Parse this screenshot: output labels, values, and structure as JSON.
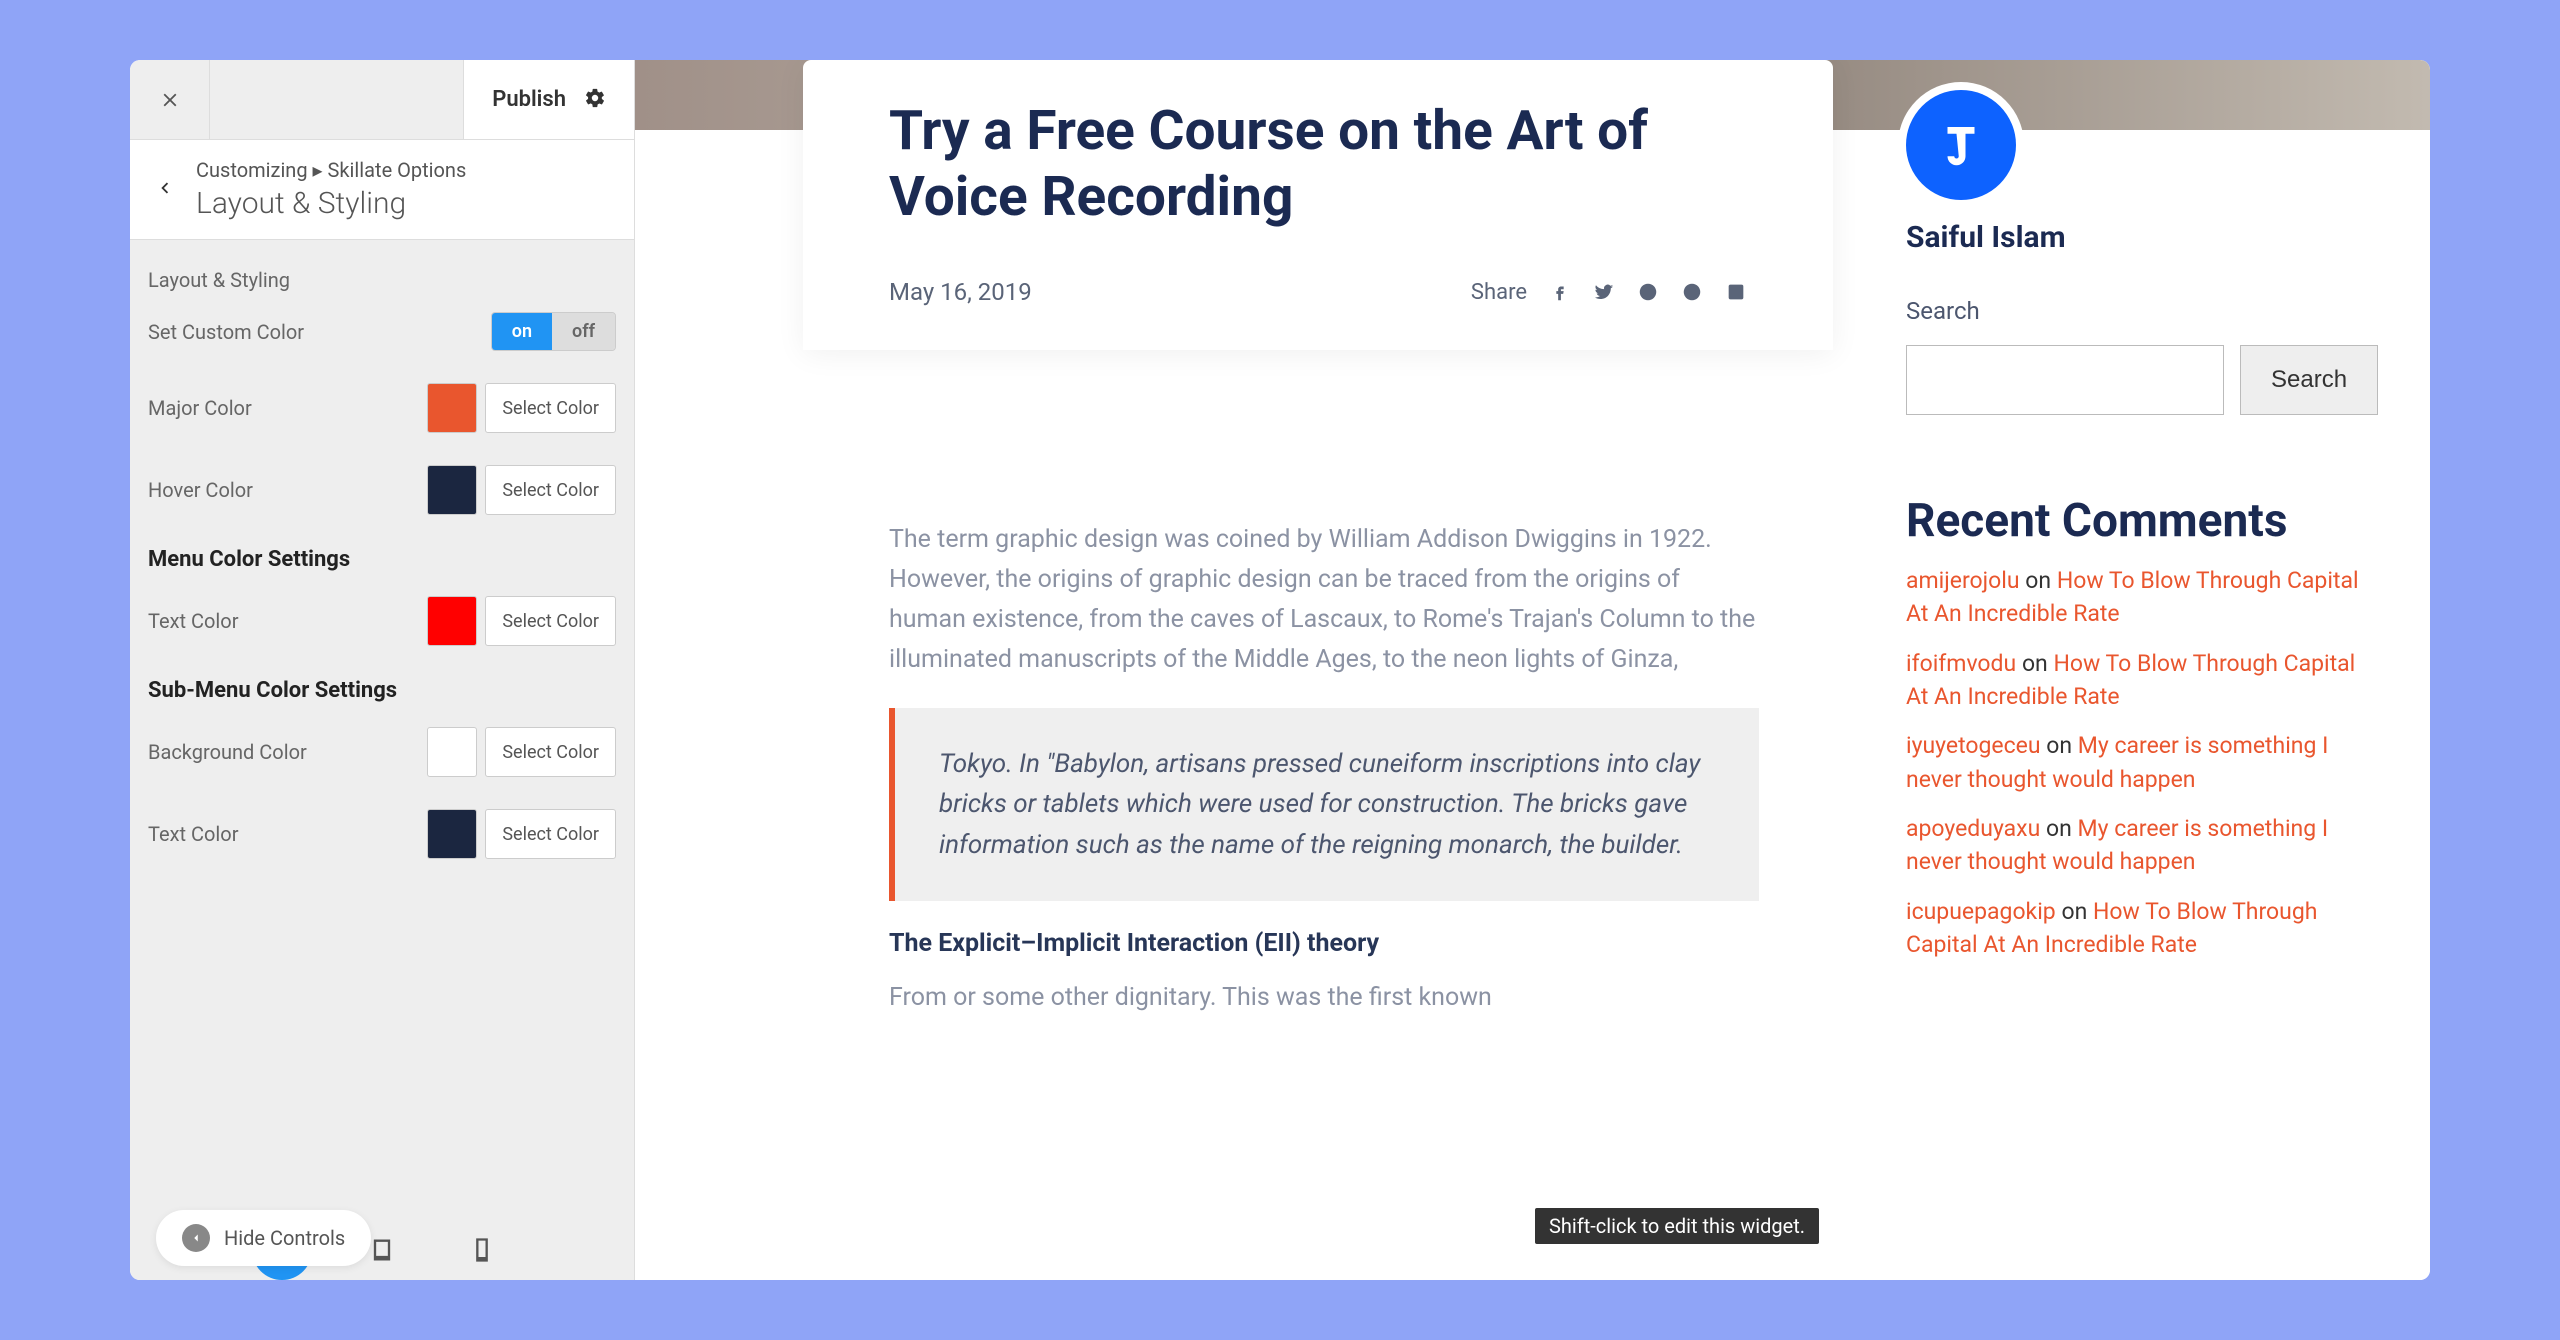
{
  "customizer": {
    "publish_label": "Publish",
    "breadcrumb_prefix": "Customizing ▸ Skillate Options",
    "breadcrumb_title": "Layout & Styling",
    "section_label": "Layout & Styling",
    "rows": {
      "set_custom_color": {
        "label": "Set Custom Color",
        "on": "on",
        "off": "off"
      },
      "major_color": {
        "label": "Major Color",
        "button": "Select Color",
        "swatch": "#e9562e"
      },
      "hover_color": {
        "label": "Hover Color",
        "button": "Select Color",
        "swatch": "#1b2640"
      },
      "menu_heading": "Menu Color Settings",
      "text_color": {
        "label": "Text Color",
        "button": "Select Color",
        "swatch": "#ff0000"
      },
      "submenu_heading": "Sub-Menu Color Settings",
      "bg_color": {
        "label": "Background Color",
        "button": "Select Color",
        "swatch": "#ffffff"
      },
      "sub_text_color": {
        "label": "Text Color",
        "button": "Select Color",
        "swatch": "#1b2640"
      }
    },
    "hide_controls": "Hide Controls"
  },
  "article": {
    "title": "Try a Free Course on the Art of Voice Recording",
    "date": "May 16, 2019",
    "share_label": "Share",
    "p1": "The term graphic design was coined by William Addison Dwiggins in 1922. However, the origins of graphic design can be traced from the origins of human existence, from the caves of Lascaux, to Rome's Trajan's Column to the illuminated manuscripts of the Middle Ages, to the neon lights of Ginza,",
    "quote": "Tokyo. In \"Babylon, artisans pressed cuneiform inscriptions into clay bricks or tablets which were used for construction. The bricks gave information such as the name of the reigning monarch, the builder.",
    "h3": "The Explicit–Implicit Interaction (EII) theory",
    "p2": "From or some other dignitary. This was the first known"
  },
  "sidebar_widget": {
    "author": "Saiful Islam",
    "search_label": "Search",
    "search_button": "Search",
    "recent_title": "Recent Comments",
    "comments": [
      {
        "author": "amijerojolu",
        "on": "on",
        "post": "How To Blow Through Capital At An Incredible Rate"
      },
      {
        "author": "ifoifmvodu",
        "on": "on",
        "post": "How To Blow Through Capital At An Incredible Rate"
      },
      {
        "author": "iyuyetogeceu",
        "on": "on",
        "post": "My career is something I never thought would happen"
      },
      {
        "author": "apoyeduyaxu",
        "on": "on",
        "post": "My career is something I never thought would happen"
      },
      {
        "author": "icupuepagokip",
        "on": "on",
        "post": "How To Blow Through Capital At An Incredible Rate"
      }
    ]
  },
  "tooltip": "Shift-click to edit this widget."
}
